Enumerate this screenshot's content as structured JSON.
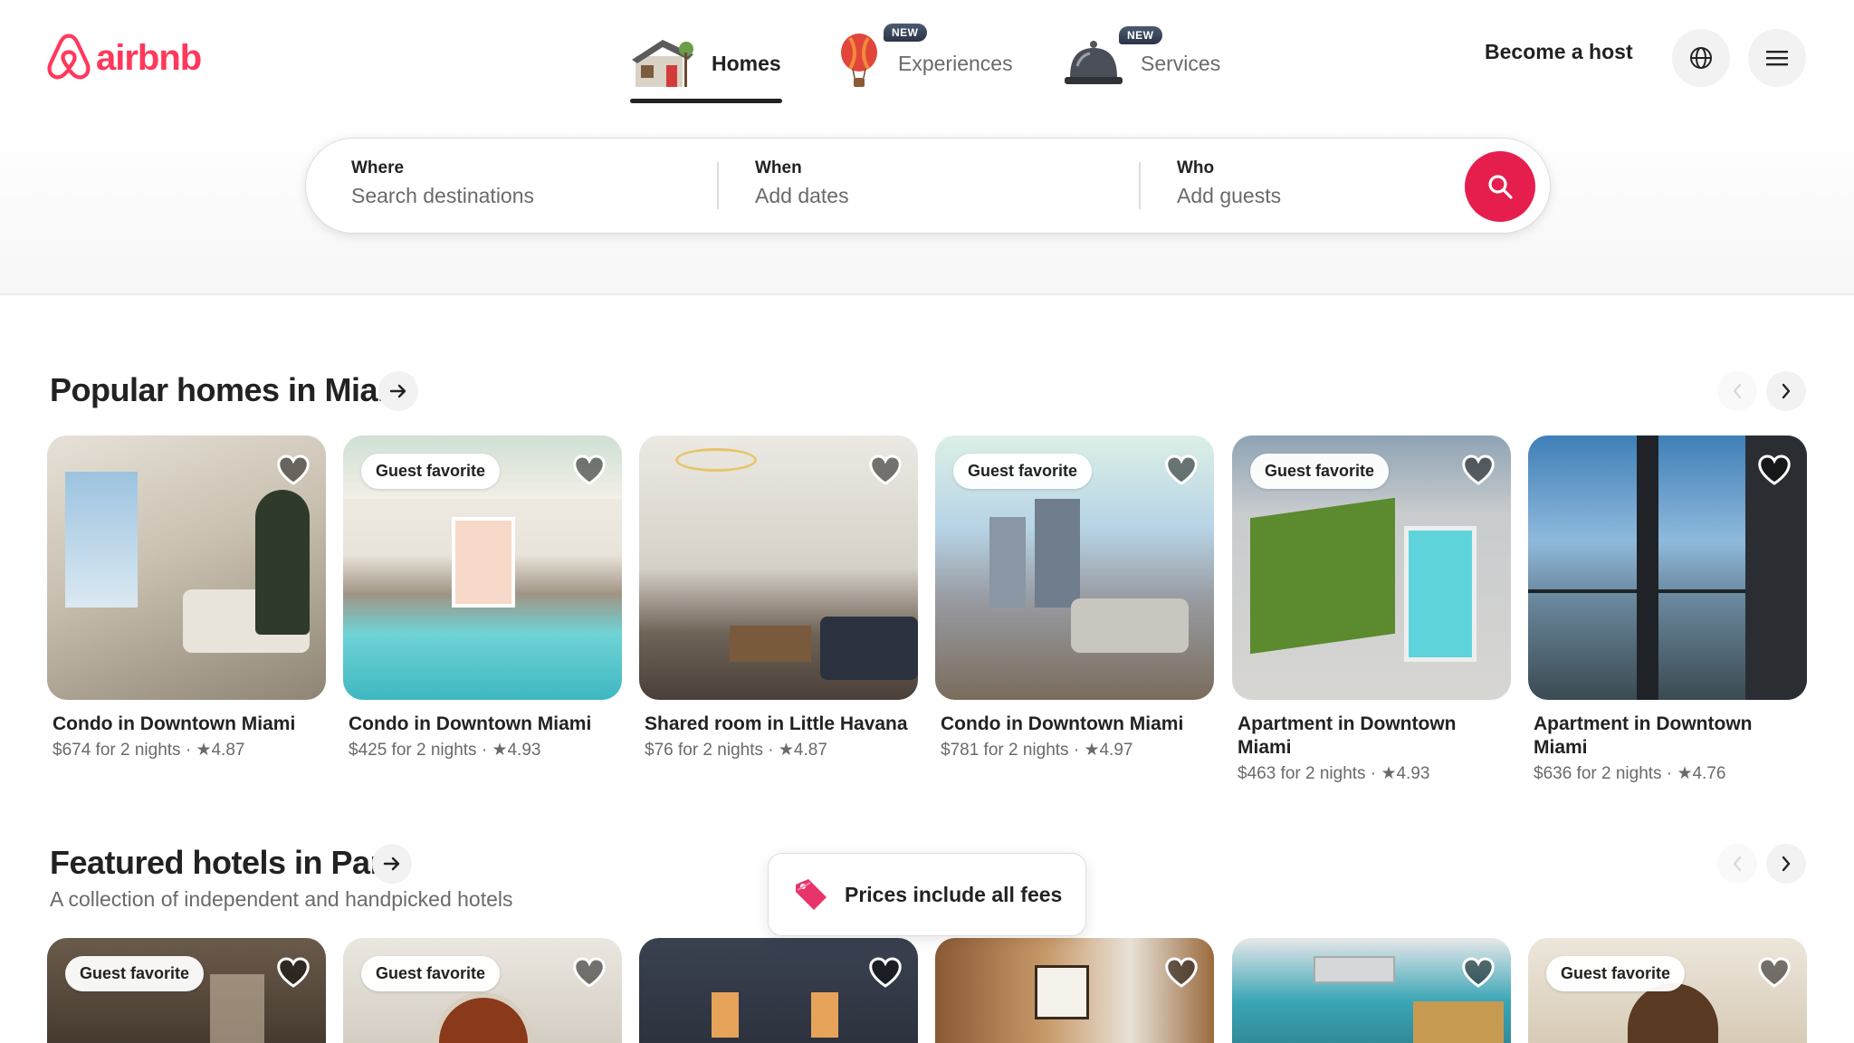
{
  "brand": {
    "name": "airbnb",
    "color": "#ff385c"
  },
  "nav": {
    "tabs": [
      {
        "label": "Homes",
        "icon": "house-icon",
        "active": true,
        "badge": ""
      },
      {
        "label": "Experiences",
        "icon": "hot-air-balloon-icon",
        "active": false,
        "badge": "NEW"
      },
      {
        "label": "Services",
        "icon": "service-bell-icon",
        "active": false,
        "badge": "NEW"
      }
    ],
    "become_host": "Become a host",
    "globe_icon": "globe-icon",
    "menu_icon": "hamburger-menu-icon"
  },
  "search": {
    "where_label": "Where",
    "where_value": "Search destinations",
    "when_label": "When",
    "when_value": "Add dates",
    "who_label": "Who",
    "who_value": "Add guests",
    "button_icon": "search-icon",
    "button_color": "#e51e4d"
  },
  "popular": {
    "title": "Popular homes in Miami",
    "listings": [
      {
        "badge": "",
        "title": "Condo in Downtown Miami",
        "price": "$674 for 2 nights",
        "rating": "4.87"
      },
      {
        "badge": "Guest favorite",
        "title": "Condo in Downtown Miami",
        "price": "$425 for 2 nights",
        "rating": "4.93"
      },
      {
        "badge": "",
        "title": "Shared room in Little Havana",
        "price": "$76 for 2 nights",
        "rating": "4.87"
      },
      {
        "badge": "Guest favorite",
        "title": "Condo in Downtown Miami",
        "price": "$781 for 2 nights",
        "rating": "4.97"
      },
      {
        "badge": "Guest favorite",
        "title": "Apartment in Downtown Miami",
        "price": "$463 for 2 nights",
        "rating": "4.93"
      },
      {
        "badge": "",
        "title": "Apartment in Downtown Miami",
        "price": "$636 for 2 nights",
        "rating": "4.76"
      }
    ]
  },
  "featured": {
    "title": "Featured hotels in Paris",
    "subtitle": "A collection of independent and handpicked hotels",
    "listings": [
      {
        "badge": "Guest favorite"
      },
      {
        "badge": "Guest favorite"
      },
      {
        "badge": ""
      },
      {
        "badge": ""
      },
      {
        "badge": ""
      },
      {
        "badge": "Guest favorite"
      }
    ]
  },
  "toast": {
    "text": "Prices include all fees",
    "icon": "price-tag-icon"
  },
  "separator": "·",
  "star": "★"
}
